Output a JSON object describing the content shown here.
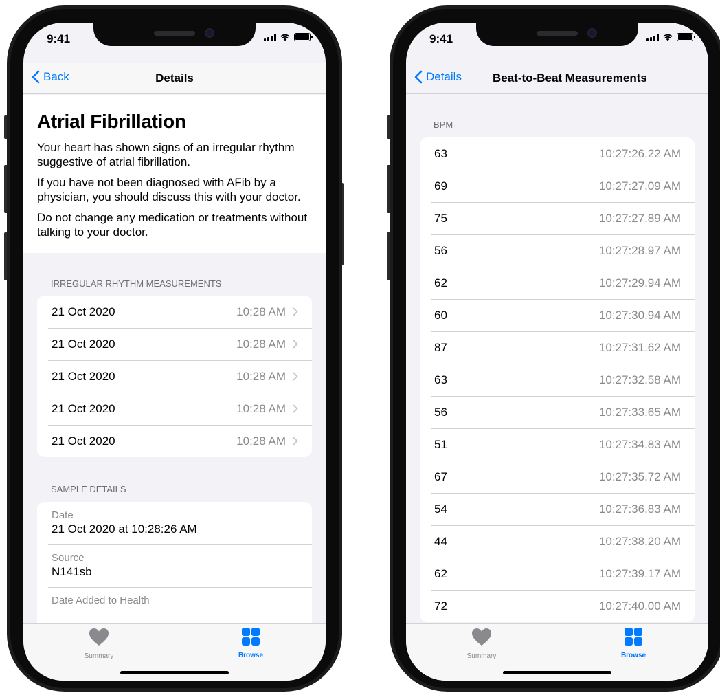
{
  "status_bar": {
    "time": "9:41"
  },
  "tab_bar": {
    "summary_label": "Summary",
    "browse_label": "Browse"
  },
  "colors": {
    "accent": "#007aff",
    "background": "#f2f2f7",
    "separator": "#d1d1d6",
    "secondary_text": "#8a8a8e"
  },
  "icons": {
    "back": "chevron-left-icon",
    "row_disclosure": "chevron-right-icon",
    "summary_tab": "heart-icon",
    "browse_tab": "grid-icon"
  },
  "details_screen": {
    "back_label": "Back",
    "title": "Details",
    "info": {
      "heading": "Atrial Fibrillation",
      "paragraphs": [
        "Your heart has shown signs of an irregular rhythm suggestive of atrial fibrillation.",
        "If you have not been diagnosed with AFib by a physician, you should discuss this with your doctor.",
        "Do not change any medication or treatments without talking to your doctor."
      ]
    },
    "irregular_rhythm": {
      "header": "IRREGULAR RHYTHM MEASUREMENTS",
      "rows": [
        {
          "date": "21 Oct 2020",
          "time": "10:28 AM"
        },
        {
          "date": "21 Oct 2020",
          "time": "10:28 AM"
        },
        {
          "date": "21 Oct 2020",
          "time": "10:28 AM"
        },
        {
          "date": "21 Oct 2020",
          "time": "10:28 AM"
        },
        {
          "date": "21 Oct 2020",
          "time": "10:28 AM"
        }
      ]
    },
    "sample_details": {
      "header": "SAMPLE DETAILS",
      "rows": [
        {
          "label": "Date",
          "value": "21 Oct 2020 at 10:28:26 AM"
        },
        {
          "label": "Source",
          "value": "N141sb"
        },
        {
          "label": "Date Added to Health",
          "value": ""
        }
      ]
    }
  },
  "beat_screen": {
    "back_label": "Details",
    "title": "Beat-to-Beat Measurements",
    "section_header": "BPM",
    "rows": [
      {
        "bpm": "63",
        "time": "10:27:26.22 AM"
      },
      {
        "bpm": "69",
        "time": "10:27:27.09 AM"
      },
      {
        "bpm": "75",
        "time": "10:27:27.89 AM"
      },
      {
        "bpm": "56",
        "time": "10:27:28.97 AM"
      },
      {
        "bpm": "62",
        "time": "10:27:29.94 AM"
      },
      {
        "bpm": "60",
        "time": "10:27:30.94 AM"
      },
      {
        "bpm": "87",
        "time": "10:27:31.62 AM"
      },
      {
        "bpm": "63",
        "time": "10:27:32.58 AM"
      },
      {
        "bpm": "56",
        "time": "10:27:33.65 AM"
      },
      {
        "bpm": "51",
        "time": "10:27:34.83 AM"
      },
      {
        "bpm": "67",
        "time": "10:27:35.72 AM"
      },
      {
        "bpm": "54",
        "time": "10:27:36.83 AM"
      },
      {
        "bpm": "44",
        "time": "10:27:38.20 AM"
      },
      {
        "bpm": "62",
        "time": "10:27:39.17 AM"
      },
      {
        "bpm": "72",
        "time": "10:27:40.00 AM"
      }
    ]
  }
}
